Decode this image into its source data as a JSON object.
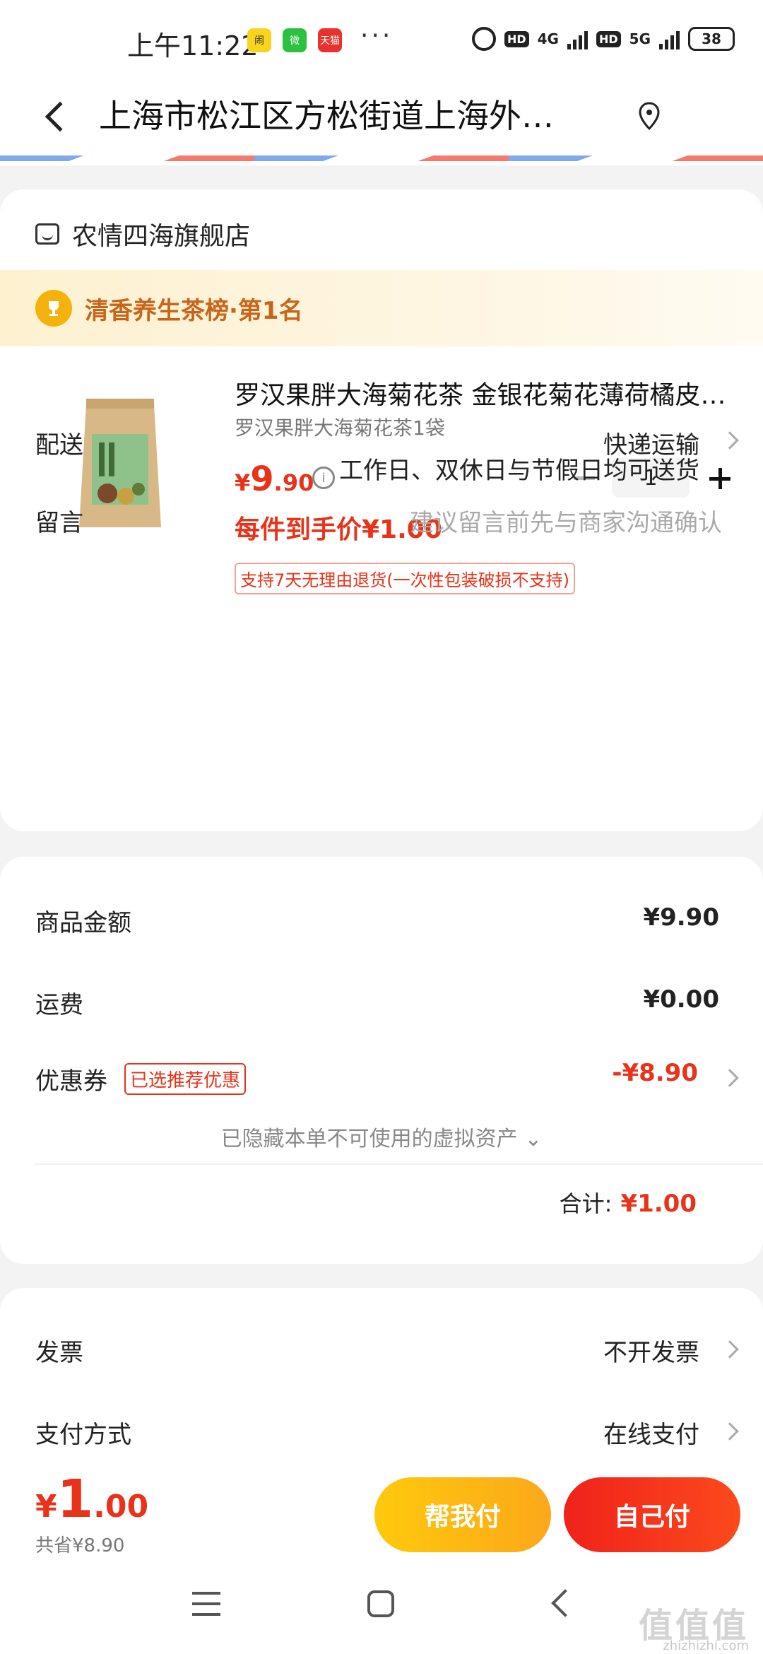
{
  "status_bar": {
    "time": "上午11:22",
    "app_icons": [
      "bell-app-icon",
      "wechat-icon",
      "tianmao-icon"
    ],
    "app_icon_labels": [
      "闹",
      "微",
      "天猫"
    ],
    "more": "···",
    "hd1": "HD",
    "net1": "4G",
    "hd2": "HD",
    "net2": "5G",
    "battery": "38"
  },
  "header": {
    "address": "上海市松江区方松街道上海外…"
  },
  "shop": {
    "name": "农情四海旗舰店",
    "rank": "清香养生茶榜·第1名"
  },
  "product": {
    "title": "罗汉果胖大海菊花茶 金银花菊花薄荷橘皮…",
    "spec": "罗汉果胖大海菊花茶1袋",
    "price_currency": "¥",
    "price_int": "9",
    "price_dec": ".90",
    "info_icon_glyph": "i",
    "quantity": "1",
    "final_price": "每件到手价¥1.00",
    "return_policy": "支持7天无理由退货(一次性包装破损不支持)"
  },
  "delivery": {
    "label": "配送",
    "method": "快递运输",
    "note": "工作日、双休日与节假日均可送货"
  },
  "message": {
    "label": "留言",
    "placeholder": "建议留言前先与商家沟通确认"
  },
  "summary": {
    "goods_label": "商品金额",
    "goods_value": "¥9.90",
    "shipping_label": "运费",
    "shipping_value": "¥0.00",
    "coupon_label": "优惠券",
    "coupon_tag": "已选推荐优惠",
    "coupon_value": "-¥8.90",
    "hidden_assets": "已隐藏本单不可使用的虚拟资产 ⌄",
    "total_label": "合计:",
    "total_value": "¥1.00"
  },
  "invoice": {
    "label": "发票",
    "value": "不开发票"
  },
  "payment": {
    "label": "支付方式",
    "value": "在线支付"
  },
  "bottom": {
    "currency": "¥",
    "amount_int": "1",
    "amount_dec": ".00",
    "saved": "共省¥8.90",
    "help_pay": "帮我付",
    "self_pay": "自己付"
  },
  "watermark": {
    "main": "值值值",
    "sub": "zhizhizhi.com"
  },
  "colors": {
    "accent_red": "#e9321a",
    "accent_orange": "#fbb21a",
    "rank_text": "#c7651a"
  }
}
